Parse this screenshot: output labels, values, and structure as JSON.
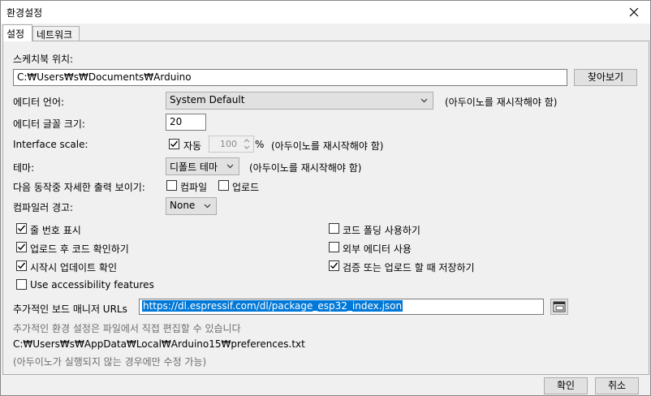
{
  "window": {
    "title": "환경설정"
  },
  "tabs": [
    {
      "label": "설정"
    },
    {
      "label": "네트워크"
    }
  ],
  "sketchbook": {
    "label": "스케치북 위치:",
    "path": "C:₩Users₩s₩Documents₩Arduino",
    "browse_label": "찾아보기"
  },
  "editor_language": {
    "label": "에디터 언어:",
    "value": "System Default",
    "note": "(아두이노를 재시작해야 함)"
  },
  "editor_font_size": {
    "label": "에디터 글꼴 크기:",
    "value": "20"
  },
  "interface_scale": {
    "label": "Interface scale:",
    "auto_label": "자동",
    "auto_checked": true,
    "value": "100",
    "unit": "%",
    "note": "(아두이노를 재시작해야 함)"
  },
  "theme": {
    "label": "테마:",
    "value": "디폴트 테마",
    "note": "(아두이노를 재시작해야 함)"
  },
  "verbose_output": {
    "label": "다음 동작중 자세한 출력 보이기:",
    "compile_label": "컴파일",
    "compile_checked": false,
    "upload_label": "업로드",
    "upload_checked": false
  },
  "compiler_warnings": {
    "label": "컴파일러 경고:",
    "value": "None"
  },
  "options": {
    "line_numbers": {
      "label": "줄 번호 표시",
      "checked": true
    },
    "verify_after_upload": {
      "label": "업로드 후 코드 확인하기",
      "checked": true
    },
    "check_updates": {
      "label": "시작시 업데이트 확인",
      "checked": true
    },
    "accessibility": {
      "label": "Use accessibility features",
      "checked": false
    },
    "code_folding": {
      "label": "코드 폴딩 사용하기",
      "checked": false
    },
    "external_editor": {
      "label": "외부 에디터 사용",
      "checked": false
    },
    "save_on_verify": {
      "label": "검증 또는 업로드 할 때 저장하기",
      "checked": true
    }
  },
  "board_urls": {
    "label": "추가적인 보드 매니저 URLs",
    "value": "https://dl.espressif.com/dl/package_esp32_index.json",
    "button_icon": "window-list-icon"
  },
  "prefs_file": {
    "hint": "추가적인 환경 설정은 파일에서 직접 편집할 수 있습니다",
    "path": "C:₩Users₩s₩AppData₩Local₩Arduino15₩preferences.txt",
    "note": "(아두이노가 실행되지 않는 경우에만 수정 가능)"
  },
  "footer": {
    "ok_label": "확인",
    "cancel_label": "취소"
  }
}
